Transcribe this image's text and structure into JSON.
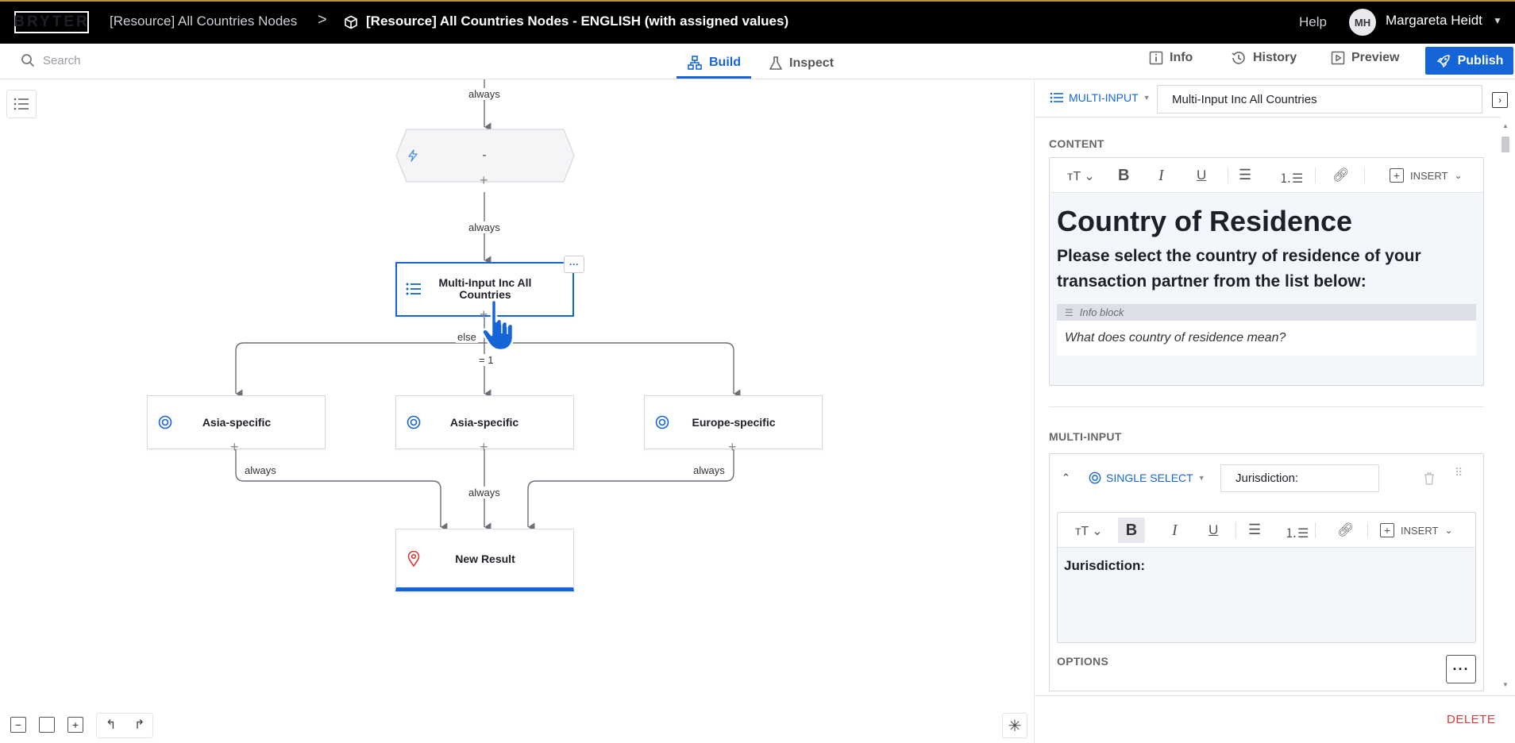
{
  "app": {
    "logo": "BRYTER",
    "breadcrumb_parent": "[Resource] All Countries Nodes",
    "breadcrumb_separator": ">",
    "breadcrumb_current": "[Resource] All Countries Nodes - ENGLISH (with assigned values)",
    "help_label": "Help",
    "user_initials": "MH",
    "user_name": "Margareta Heidt"
  },
  "toolbar": {
    "search_placeholder": "Search",
    "tabs": [
      {
        "label": "Build",
        "active": true
      },
      {
        "label": "Inspect",
        "active": false
      }
    ],
    "right_tabs": [
      {
        "label": "Info"
      },
      {
        "label": "History"
      },
      {
        "label": "Preview"
      }
    ],
    "publish_label": "Publish"
  },
  "canvas": {
    "top_action_node": {
      "label": "-"
    },
    "selected_node": {
      "label": "Multi-Input Inc All Countries",
      "menu": "···"
    },
    "nodes": [
      {
        "label": "Asia-specific"
      },
      {
        "label": "Asia-specific"
      },
      {
        "label": "Europe-specific"
      }
    ],
    "result_node": {
      "label": "New Result"
    },
    "edges": {
      "always": "always",
      "else": "else",
      "eq1": "= 1"
    }
  },
  "panel": {
    "node_type": "MULTI-INPUT",
    "node_name": "Multi-Input Inc All Countries",
    "content_title": "CONTENT",
    "insert_label": "INSERT",
    "heading1": "Country of Residence",
    "heading2": "Please select the country of residence of your transaction partner from the list below:",
    "info_block_label": "Info block",
    "info_block_text": "What does country of residence mean?",
    "multi_input_title": "MULTI-INPUT",
    "input_type": "SINGLE SELECT",
    "input_name": "Jurisdiction:",
    "input_body": "Jurisdiction:",
    "options_title": "OPTIONS",
    "options_menu": "···",
    "delete_label": "DELETE"
  },
  "colors": {
    "accent": "#1565d8",
    "topbar": "#000000",
    "danger": "#d63a3a"
  }
}
